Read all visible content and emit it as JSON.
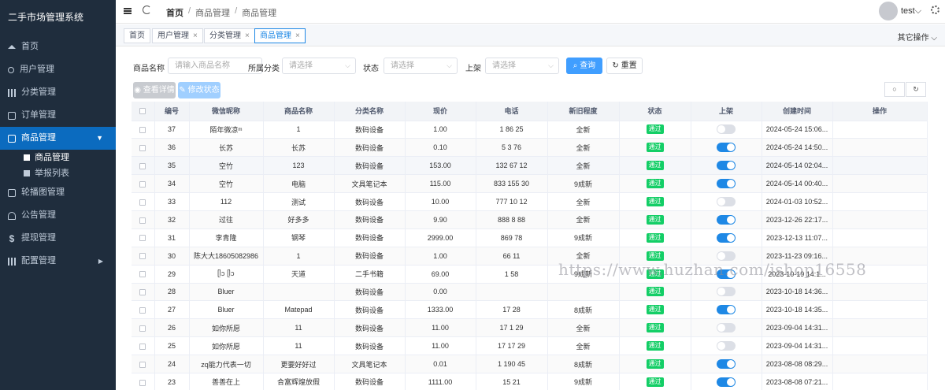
{
  "app": {
    "title": "二手市场管理系统"
  },
  "sidebar": {
    "items": [
      {
        "label": "首页",
        "icon": "home-icon"
      },
      {
        "label": "用户管理",
        "icon": "user-icon"
      },
      {
        "label": "分类管理",
        "icon": "grid-icon"
      },
      {
        "label": "订单管理",
        "icon": "clipboard-icon"
      },
      {
        "label": "商品管理",
        "icon": "store-icon",
        "active": true
      },
      {
        "label": "轮播图管理",
        "icon": "image-icon"
      },
      {
        "label": "公告管理",
        "icon": "bell-icon"
      },
      {
        "label": "提现管理",
        "icon": "dollar-icon"
      },
      {
        "label": "配置管理",
        "icon": "chart-icon"
      }
    ],
    "subitems": [
      {
        "label": "商品管理"
      },
      {
        "label": "举报列表"
      }
    ]
  },
  "header": {
    "breadcrumb": [
      "首页",
      "商品管理",
      "商品管理"
    ],
    "user": "test"
  },
  "tabs": [
    {
      "label": "首页"
    },
    {
      "label": "用户管理"
    },
    {
      "label": "分类管理"
    },
    {
      "label": "商品管理"
    }
  ],
  "more_ops": "其它操作",
  "filter": {
    "name_label": "商品名称",
    "name_placeholder": "请输入商品名称",
    "category_label": "所属分类",
    "category_placeholder": "请选择",
    "status_label": "状态",
    "status_placeholder": "请选择",
    "shelf_label": "上架",
    "shelf_placeholder": "请选择",
    "search_btn": "查询",
    "reset_btn": "重置"
  },
  "toolbar": {
    "detail_btn": "查看详情",
    "edit_status_btn": "修改状态"
  },
  "table": {
    "columns": [
      "编号",
      "微信昵称",
      "商品名称",
      "分类名称",
      "现价",
      "电话",
      "新旧程度",
      "状态",
      "上架",
      "创建时间",
      "操作"
    ],
    "rows": [
      {
        "id": "37",
        "nick": "陌年微凉ᵐ",
        "name": "1",
        "cat": "数码设备",
        "price": "1.00",
        "phone": "1 86 25",
        "cond": "全新",
        "status": "通过",
        "on": false,
        "time": "2024-05-24 15:06..."
      },
      {
        "id": "36",
        "nick": "长苏",
        "name": "长苏",
        "cat": "数码设备",
        "price": "0.10",
        "phone": "5 3 76",
        "cond": "全新",
        "status": "通过",
        "on": true,
        "time": "2024-05-24 14:50..."
      },
      {
        "id": "35",
        "nick": "空竹",
        "name": "123",
        "cat": "数码设备",
        "price": "153.00",
        "phone": "132 67 12",
        "cond": "全新",
        "status": "通过",
        "on": true,
        "time": "2024-05-14 02:04..."
      },
      {
        "id": "34",
        "nick": "空竹",
        "name": "电脑",
        "cat": "文具笔记本",
        "price": "115.00",
        "phone": "833 155 30",
        "cond": "9成新",
        "status": "通过",
        "on": true,
        "time": "2024-05-14 00:40..."
      },
      {
        "id": "33",
        "nick": "112",
        "name": "测试",
        "cat": "数码设备",
        "price": "10.00",
        "phone": "777 10 12",
        "cond": "全新",
        "status": "通过",
        "on": false,
        "time": "2024-01-03 10:52..."
      },
      {
        "id": "32",
        "nick": "过往",
        "name": "好多多",
        "cat": "数码设备",
        "price": "9.90",
        "phone": "888 8 88",
        "cond": "全新",
        "status": "通过",
        "on": true,
        "time": "2023-12-26 22:17..."
      },
      {
        "id": "31",
        "nick": "李青隆",
        "name": "钢琴",
        "cat": "数码设备",
        "price": "2999.00",
        "phone": "869 78",
        "cond": "9成新",
        "status": "通过",
        "on": true,
        "time": "2023-12-13 11:07..."
      },
      {
        "id": "30",
        "nick": "陈大大18605082986",
        "name": "1",
        "cat": "数码设备",
        "price": "1.00",
        "phone": "66 11",
        "cond": "全新",
        "status": "通过",
        "on": false,
        "time": "2023-11-23 09:16..."
      },
      {
        "id": "29",
        "nick": "ᥫᩣ ᥫᩣ",
        "name": "天道",
        "cat": "二手书籍",
        "price": "69.00",
        "phone": "1 58",
        "cond": "9成新",
        "status": "通过",
        "on": true,
        "time": "2023-10-19 14:1..."
      },
      {
        "id": "28",
        "nick": "Bluer",
        "name": "",
        "cat": "数码设备",
        "price": "0.00",
        "phone": "",
        "cond": "",
        "status": "通过",
        "on": false,
        "time": "2023-10-18 14:36..."
      },
      {
        "id": "27",
        "nick": "Bluer",
        "name": "Matepad",
        "cat": "数码设备",
        "price": "1333.00",
        "phone": "17 28",
        "cond": "8成新",
        "status": "通过",
        "on": true,
        "time": "2023-10-18 14:35..."
      },
      {
        "id": "26",
        "nick": "如你所愿",
        "name": "11",
        "cat": "数码设备",
        "price": "11.00",
        "phone": "17 1 29",
        "cond": "全新",
        "status": "通过",
        "on": false,
        "time": "2023-09-04 14:31..."
      },
      {
        "id": "25",
        "nick": "如你所愿",
        "name": "11",
        "cat": "数码设备",
        "price": "11.00",
        "phone": "17 17 29",
        "cond": "全新",
        "status": "通过",
        "on": false,
        "time": "2023-09-04 14:31..."
      },
      {
        "id": "24",
        "nick": "zq能力代表一切",
        "name": "更要好好过",
        "cat": "文具笔记本",
        "price": "0.01",
        "phone": "1 190 45",
        "cond": "8成新",
        "status": "通过",
        "on": true,
        "time": "2023-08-08 08:29..."
      },
      {
        "id": "23",
        "nick": "善善在上",
        "name": "合富辉煌放假",
        "cat": "数码设备",
        "price": "1111.00",
        "phone": "15 21",
        "cond": "9成新",
        "status": "通过",
        "on": true,
        "time": "2023-08-08 07:21..."
      }
    ]
  },
  "watermark": "https://www.huzhan.com/ishop16558",
  "colors": {
    "sidebar_bg": "#1f2d3d",
    "active": "#0b6bbf",
    "primary": "#409eff",
    "pass": "#13ce66"
  }
}
